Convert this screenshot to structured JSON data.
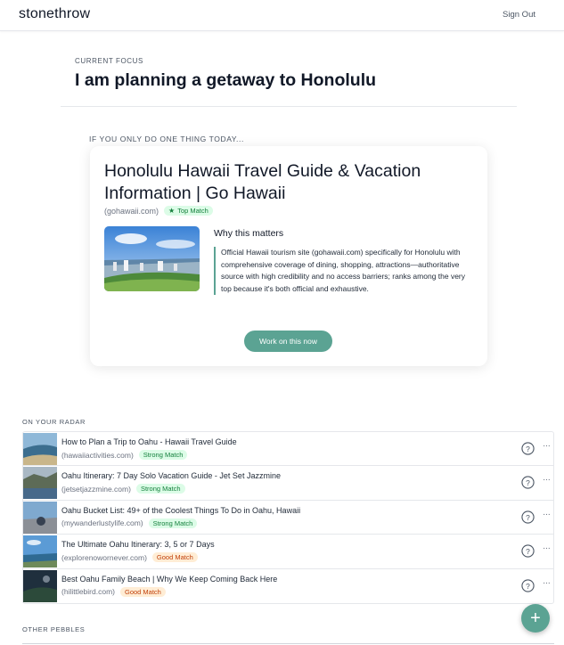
{
  "header": {
    "brand": "stonethrow",
    "sign_out": "Sign Out"
  },
  "focus": {
    "label": "CURRENT FOCUS",
    "title": "I am planning a getaway to Honolulu"
  },
  "one_thing": {
    "label": "IF YOU ONLY DO ONE THING TODAY...",
    "title": "Honolulu Hawaii Travel Guide & Vacation Information | Go Hawaii",
    "domain": "(gohawaii.com)",
    "badge": "Top Match",
    "badge_icon": "star-icon",
    "why_title": "Why this matters",
    "why_body": "Official Hawaii tourism site (gohawaii.com) specifically for Honolulu with comprehensive coverage of dining, shopping, attractions—authoritative source with high credibility and no access barriers; ranks among the very top because it's both official and exhaustive.",
    "button": "Work on this now"
  },
  "radar": {
    "label": "ON YOUR RADAR",
    "items": [
      {
        "title": "How to Plan a Trip to Oahu - Hawaii Travel Guide",
        "domain": "(hawaiiactivities.com)",
        "badge": "Strong Match",
        "level": "strong"
      },
      {
        "title": "Oahu Itinerary: 7 Day Solo Vacation Guide - Jet Set Jazzmine",
        "domain": "(jetsetjazzmine.com)",
        "badge": "Strong Match",
        "level": "strong"
      },
      {
        "title": "Oahu Bucket List: 49+ of the Coolest Things To Do in Oahu, Hawaii",
        "domain": "(mywanderlustylife.com)",
        "badge": "Strong Match",
        "level": "strong"
      },
      {
        "title": "The Ultimate Oahu Itinerary: 3, 5 or 7 Days",
        "domain": "(explorenowornever.com)",
        "badge": "Good Match",
        "level": "good"
      },
      {
        "title": "Best Oahu Family Beach | Why We Keep Coming Back Here",
        "domain": "(hilittlebird.com)",
        "badge": "Good Match",
        "level": "good"
      }
    ]
  },
  "pebbles": {
    "label": "OTHER PEBBLES"
  },
  "colors": {
    "accent": "#5ba393",
    "strong_bg": "#dcfce7",
    "strong_fg": "#15803d",
    "good_bg": "#ffedd5",
    "good_fg": "#c2410c"
  },
  "icons": {
    "help": "question-circle-icon",
    "more": "more-dots-icon",
    "fab": "plus-icon"
  }
}
